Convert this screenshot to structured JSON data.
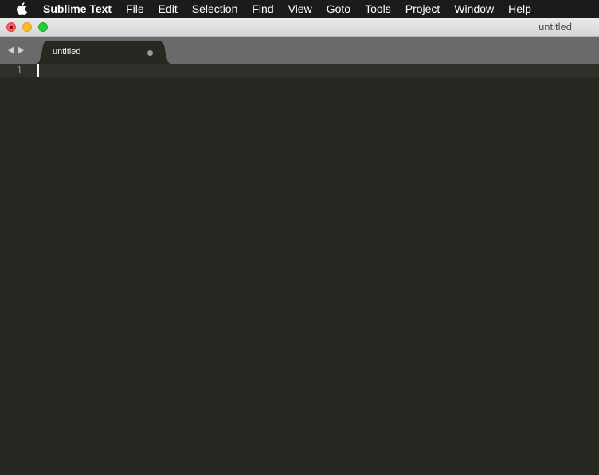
{
  "menubar": {
    "apple_icon": "apple-logo-icon",
    "app_name": "Sublime Text",
    "items": [
      "File",
      "Edit",
      "Selection",
      "Find",
      "View",
      "Goto",
      "Tools",
      "Project",
      "Window",
      "Help"
    ]
  },
  "window": {
    "title": "untitled",
    "controls": [
      "close",
      "minimize",
      "zoom"
    ]
  },
  "tabs": [
    {
      "label": "untitled",
      "modified": true,
      "active": true
    }
  ],
  "editor": {
    "line_numbers": [
      "1"
    ],
    "content": "",
    "theme_background": "#272822"
  }
}
